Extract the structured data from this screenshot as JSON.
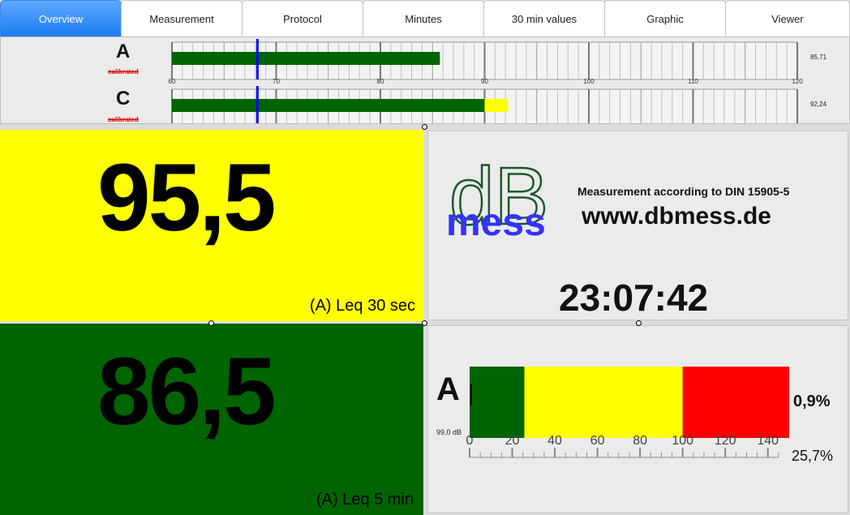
{
  "tabs": [
    {
      "label": "Overview",
      "active": true
    },
    {
      "label": "Measurement",
      "active": false
    },
    {
      "label": "Protocol",
      "active": false
    },
    {
      "label": "Minutes",
      "active": false
    },
    {
      "label": "30 min values",
      "active": false
    },
    {
      "label": "Graphic",
      "active": false
    },
    {
      "label": "Viewer",
      "active": false
    }
  ],
  "meters": {
    "scale_min": 60,
    "scale_max": 120,
    "tick_labels": [
      "60",
      "70",
      "80",
      "90",
      "100",
      "110",
      "120"
    ],
    "channels": [
      {
        "letter": "A",
        "status": "calibrated",
        "level": 85.71,
        "readout": "85,71",
        "marker": 68.2,
        "yellow_from": null
      },
      {
        "letter": "C",
        "status": "calibrated",
        "level": 92.24,
        "readout": "92,24",
        "marker": 68.2,
        "yellow_from": 90
      }
    ]
  },
  "leq30": {
    "value": "95,5",
    "label": "(A) Leq 30 sec",
    "bg": "#ffff00"
  },
  "leq5": {
    "value": "86,5",
    "label": "(A) Leq 5 min",
    "bg": "#006400"
  },
  "logo": {
    "db_text": "dB",
    "mess_text": "mess",
    "headline": "Measurement according to DIN 15905-5",
    "website": "www.dbmess.de",
    "time": "23:07:42"
  },
  "bar": {
    "letter": "A",
    "level_label": "99,0 dB",
    "green_to": 25.7,
    "yellow_to": 100,
    "red_to": 150,
    "axis_max": 150,
    "ticks": [
      "0",
      "20",
      "40",
      "60",
      "80",
      "100",
      "120",
      "140"
    ],
    "pct_top": "0,9%",
    "pct_bottom": "25,7%"
  },
  "colors": {
    "green": "#006400",
    "yellow": "#ffff00",
    "red": "#ff0000",
    "blue": "#0000ff",
    "mess": "#3333ff"
  }
}
